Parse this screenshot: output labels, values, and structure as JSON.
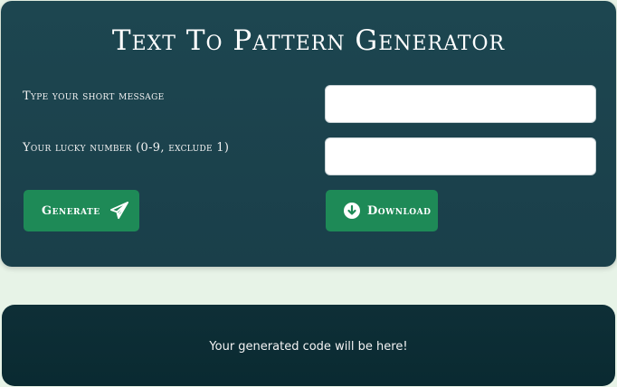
{
  "header": {
    "title": "Text To Pattern Generator"
  },
  "form": {
    "message_label": "Type your short message",
    "message_value": "",
    "number_label": "Your lucky number (0-9, exclude 1)",
    "number_value": ""
  },
  "actions": {
    "generate_label": "Generate",
    "generate_icon": "paper-plane-icon",
    "download_label": "Download",
    "download_icon": "arrow-down-circle-icon"
  },
  "output": {
    "placeholder_text": "Your generated code will be here!"
  },
  "colors": {
    "page_background": "#e7f3e7",
    "card_background": "#1d4650",
    "output_background": "#0e2f37",
    "button_green": "#1e8a57"
  }
}
